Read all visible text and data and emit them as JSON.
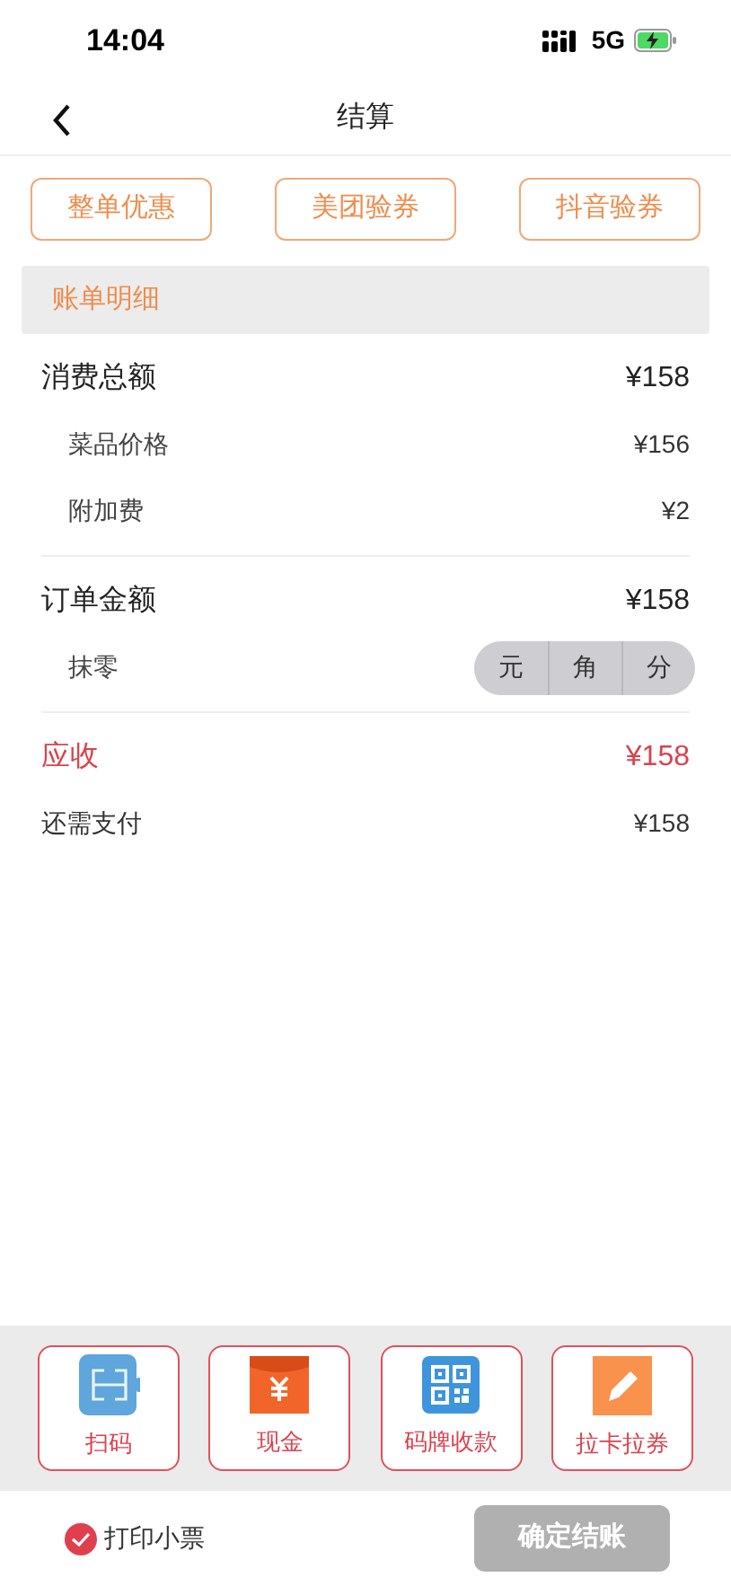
{
  "status_bar": {
    "time": "14:04",
    "network": "5G"
  },
  "nav": {
    "title": "结算"
  },
  "discount_buttons": [
    "整单优惠",
    "美团验券",
    "抖音验券"
  ],
  "section": {
    "title": "账单明细"
  },
  "groups": [
    {
      "rows": [
        {
          "kind": "main",
          "label": "消费总额",
          "value": "¥158"
        },
        {
          "kind": "sub",
          "label": "菜品价格",
          "value": "¥156"
        },
        {
          "kind": "sub",
          "label": "附加费",
          "value": "¥2"
        }
      ]
    },
    {
      "rows": [
        {
          "kind": "main",
          "label": "订单金额",
          "value": "¥158"
        },
        {
          "kind": "rounding",
          "label": "抹零",
          "options": [
            {
              "label": "元",
              "selected": false
            },
            {
              "label": "角",
              "selected": false
            },
            {
              "label": "分",
              "selected": false
            }
          ]
        }
      ]
    },
    {
      "rows": [
        {
          "kind": "due",
          "label": "应收",
          "value": "¥158"
        },
        {
          "kind": "plain",
          "label": "还需支付",
          "value": "¥158"
        }
      ]
    }
  ],
  "payment_methods": [
    {
      "kind": "scan",
      "label": "扫码"
    },
    {
      "kind": "cash",
      "label": "现金"
    },
    {
      "kind": "qr",
      "label": "码牌收款"
    },
    {
      "kind": "card",
      "label": "拉卡拉券"
    }
  ],
  "footer": {
    "print_receipt": {
      "label": "打印小票",
      "checked": true
    },
    "confirm": {
      "label": "确定结账",
      "disabled": true
    }
  }
}
